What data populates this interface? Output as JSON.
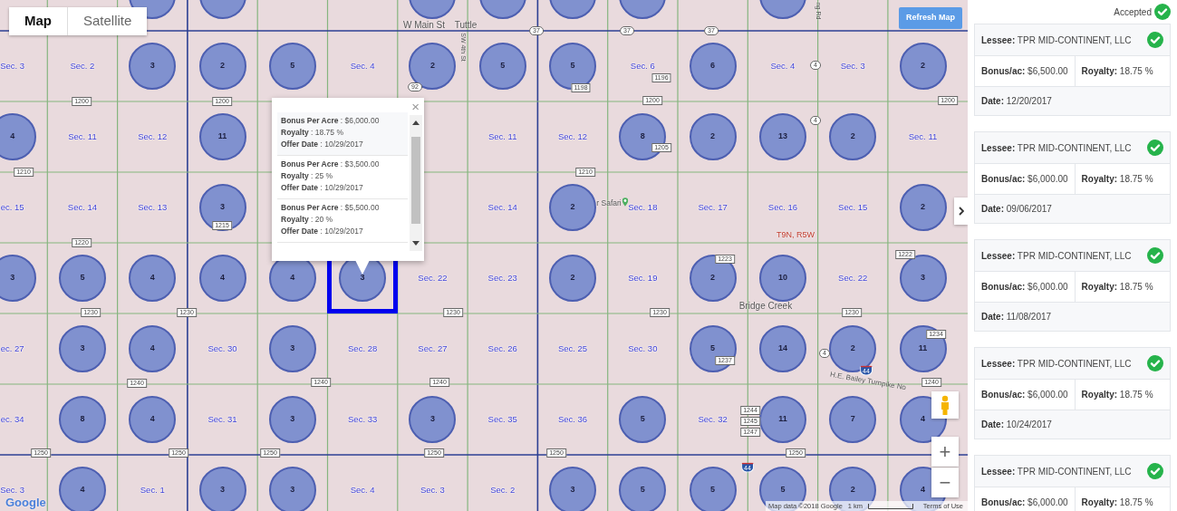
{
  "map_types": [
    {
      "label": "Map",
      "selected": true
    },
    {
      "label": "Satellite",
      "selected": false
    }
  ],
  "refresh_button": "Refresh Map",
  "map": {
    "rows": [
      [
        {
          "kind": "empty"
        },
        {
          "kind": "empty"
        },
        {
          "kind": "cut"
        },
        {
          "kind": "cut"
        },
        {
          "kind": "empty"
        },
        {
          "kind": "empty"
        },
        {
          "kind": "cut"
        },
        {
          "kind": "cut"
        },
        {
          "kind": "cut"
        },
        {
          "kind": "cut"
        },
        {
          "kind": "empty"
        },
        {
          "kind": "cut"
        },
        {
          "kind": "empty"
        },
        {
          "kind": "empty"
        }
      ],
      [
        {
          "kind": "section",
          "text": "Sec. 3"
        },
        {
          "kind": "section",
          "text": "Sec. 2"
        },
        {
          "kind": "cluster",
          "count": "3",
          "selected": false
        },
        {
          "kind": "cluster",
          "count": "2",
          "selected": false
        },
        {
          "kind": "cluster",
          "count": "5",
          "selected": false
        },
        {
          "kind": "section",
          "text": "Sec. 4"
        },
        {
          "kind": "cluster",
          "count": "2",
          "selected": false
        },
        {
          "kind": "cluster",
          "count": "5",
          "selected": false
        },
        {
          "kind": "cluster",
          "count": "5",
          "selected": false
        },
        {
          "kind": "section",
          "text": "Sec. 6"
        },
        {
          "kind": "cluster",
          "count": "6",
          "selected": false
        },
        {
          "kind": "section",
          "text": "Sec. 4"
        },
        {
          "kind": "section",
          "text": "Sec. 3"
        },
        {
          "kind": "cluster",
          "count": "2",
          "selected": false
        }
      ],
      [
        {
          "kind": "cluster",
          "count": "4",
          "selected": false
        },
        {
          "kind": "section",
          "text": "Sec. 11"
        },
        {
          "kind": "section",
          "text": "Sec. 12"
        },
        {
          "kind": "cluster",
          "count": "11",
          "selected": false
        },
        {
          "kind": "empty"
        },
        {
          "kind": "empty"
        },
        {
          "kind": "empty"
        },
        {
          "kind": "section",
          "text": "Sec. 11"
        },
        {
          "kind": "section",
          "text": "Sec. 12"
        },
        {
          "kind": "cluster",
          "count": "8",
          "selected": false
        },
        {
          "kind": "cluster",
          "count": "2",
          "selected": false
        },
        {
          "kind": "cluster",
          "count": "13",
          "selected": false
        },
        {
          "kind": "cluster",
          "count": "2",
          "selected": false
        },
        {
          "kind": "section",
          "text": "Sec. 11"
        }
      ],
      [
        {
          "kind": "section",
          "text": "ec. 15"
        },
        {
          "kind": "section",
          "text": "Sec. 14"
        },
        {
          "kind": "section",
          "text": "Sec. 13"
        },
        {
          "kind": "cluster",
          "count": "3",
          "selected": false
        },
        {
          "kind": "empty"
        },
        {
          "kind": "empty"
        },
        {
          "kind": "empty"
        },
        {
          "kind": "section",
          "text": "Sec. 14"
        },
        {
          "kind": "cluster",
          "count": "2",
          "selected": false
        },
        {
          "kind": "section",
          "text": "Sec. 18"
        },
        {
          "kind": "section",
          "text": "Sec. 17"
        },
        {
          "kind": "section",
          "text": "Sec. 16"
        },
        {
          "kind": "section",
          "text": "Sec. 15"
        },
        {
          "kind": "cluster",
          "count": "2",
          "selected": false
        }
      ],
      [
        {
          "kind": "cluster",
          "count": "3",
          "selected": false
        },
        {
          "kind": "cluster",
          "count": "5",
          "selected": false
        },
        {
          "kind": "cluster",
          "count": "4",
          "selected": false
        },
        {
          "kind": "cluster",
          "count": "4",
          "selected": false
        },
        {
          "kind": "cluster",
          "count": "4",
          "selected": false
        },
        {
          "kind": "cluster",
          "count": "3",
          "selected": true
        },
        {
          "kind": "section",
          "text": "Sec. 22"
        },
        {
          "kind": "section",
          "text": "Sec. 23"
        },
        {
          "kind": "cluster",
          "count": "2",
          "selected": false
        },
        {
          "kind": "section",
          "text": "Sec. 19"
        },
        {
          "kind": "cluster",
          "count": "2",
          "selected": false
        },
        {
          "kind": "cluster",
          "count": "10",
          "selected": false
        },
        {
          "kind": "section",
          "text": "Sec. 22"
        },
        {
          "kind": "cluster",
          "count": "3",
          "selected": false
        }
      ],
      [
        {
          "kind": "section",
          "text": "ec. 27"
        },
        {
          "kind": "cluster",
          "count": "3",
          "selected": false
        },
        {
          "kind": "cluster",
          "count": "4",
          "selected": false
        },
        {
          "kind": "section",
          "text": "Sec. 30"
        },
        {
          "kind": "cluster",
          "count": "3",
          "selected": false
        },
        {
          "kind": "section",
          "text": "Sec. 28"
        },
        {
          "kind": "section",
          "text": "Sec. 27"
        },
        {
          "kind": "section",
          "text": "Sec. 26"
        },
        {
          "kind": "section",
          "text": "Sec. 25"
        },
        {
          "kind": "section",
          "text": "Sec. 30"
        },
        {
          "kind": "cluster",
          "count": "5",
          "selected": false
        },
        {
          "kind": "cluster",
          "count": "14",
          "selected": false
        },
        {
          "kind": "cluster",
          "count": "2",
          "selected": false
        },
        {
          "kind": "cluster",
          "count": "11",
          "selected": false
        }
      ],
      [
        {
          "kind": "section",
          "text": "ec. 34"
        },
        {
          "kind": "cluster",
          "count": "8",
          "selected": false
        },
        {
          "kind": "cluster",
          "count": "4",
          "selected": false
        },
        {
          "kind": "section",
          "text": "Sec. 31"
        },
        {
          "kind": "cluster",
          "count": "3",
          "selected": false
        },
        {
          "kind": "section",
          "text": "Sec. 33"
        },
        {
          "kind": "cluster",
          "count": "3",
          "selected": false
        },
        {
          "kind": "section",
          "text": "Sec. 35"
        },
        {
          "kind": "section",
          "text": "Sec. 36"
        },
        {
          "kind": "cluster",
          "count": "5",
          "selected": false
        },
        {
          "kind": "section",
          "text": "Sec. 32"
        },
        {
          "kind": "cluster",
          "count": "11",
          "selected": false
        },
        {
          "kind": "cluster",
          "count": "7",
          "selected": false
        },
        {
          "kind": "cluster",
          "count": "4",
          "selected": false
        }
      ],
      [
        {
          "kind": "section",
          "text": "Sec. 3"
        },
        {
          "kind": "cluster",
          "count": "4",
          "selected": false
        },
        {
          "kind": "section",
          "text": "Sec. 1"
        },
        {
          "kind": "cluster",
          "count": "3",
          "selected": false
        },
        {
          "kind": "cluster",
          "count": "3",
          "selected": false
        },
        {
          "kind": "section",
          "text": "Sec. 4"
        },
        {
          "kind": "section",
          "text": "Sec. 3"
        },
        {
          "kind": "section",
          "text": "Sec. 2"
        },
        {
          "kind": "cluster",
          "count": "3",
          "selected": false
        },
        {
          "kind": "cluster",
          "count": "5",
          "selected": false
        },
        {
          "kind": "cluster",
          "count": "5",
          "selected": false
        },
        {
          "kind": "cluster",
          "count": "5",
          "selected": false
        },
        {
          "kind": "cluster",
          "count": "2",
          "selected": false
        },
        {
          "kind": "cluster",
          "count": "4",
          "selected": false
        }
      ]
    ],
    "places": [
      {
        "kind": "street",
        "text": "W Main St"
      },
      {
        "kind": "town",
        "text": "Tuttle"
      },
      {
        "kind": "street-vertical",
        "text": "SW 4th St"
      },
      {
        "kind": "street-vertical",
        "text": "ng Rd"
      },
      {
        "kind": "poi",
        "text": "r Safari"
      },
      {
        "kind": "township",
        "text": "T9N, R5W"
      },
      {
        "kind": "town",
        "text": "Bridge Creek"
      },
      {
        "kind": "highway",
        "text": "H.E. Bailey Turnpike No"
      }
    ],
    "roads": [
      {
        "kind": "county",
        "text": "1200"
      },
      {
        "kind": "county",
        "text": "1200"
      },
      {
        "kind": "county",
        "text": "1200"
      },
      {
        "kind": "county",
        "text": "1200"
      },
      {
        "kind": "county",
        "text": "1210"
      },
      {
        "kind": "county",
        "text": "1210"
      },
      {
        "kind": "county",
        "text": "1215"
      },
      {
        "kind": "county",
        "text": "1220"
      },
      {
        "kind": "county",
        "text": "1196"
      },
      {
        "kind": "county",
        "text": "1198"
      },
      {
        "kind": "county",
        "text": "1205"
      },
      {
        "kind": "state",
        "text": "92"
      },
      {
        "kind": "state",
        "text": "37"
      },
      {
        "kind": "state",
        "text": "37"
      },
      {
        "kind": "state",
        "text": "37"
      },
      {
        "kind": "state",
        "text": "4"
      },
      {
        "kind": "state",
        "text": "4"
      },
      {
        "kind": "county",
        "text": "1223"
      },
      {
        "kind": "county",
        "text": "1222"
      },
      {
        "kind": "county",
        "text": "1230"
      },
      {
        "kind": "county",
        "text": "1230"
      },
      {
        "kind": "county",
        "text": "1230"
      },
      {
        "kind": "county",
        "text": "1230"
      },
      {
        "kind": "county",
        "text": "1230"
      },
      {
        "kind": "county",
        "text": "1234"
      },
      {
        "kind": "county",
        "text": "1237"
      },
      {
        "kind": "state",
        "text": "4"
      },
      {
        "kind": "interstate",
        "text": "44"
      },
      {
        "kind": "county",
        "text": "1240"
      },
      {
        "kind": "county",
        "text": "1240"
      },
      {
        "kind": "county",
        "text": "1240"
      },
      {
        "kind": "county",
        "text": "1240"
      },
      {
        "kind": "county",
        "text": "1244"
      },
      {
        "kind": "county",
        "text": "1245"
      },
      {
        "kind": "county",
        "text": "1247"
      },
      {
        "kind": "county",
        "text": "1250"
      },
      {
        "kind": "county",
        "text": "1250"
      },
      {
        "kind": "county",
        "text": "1250"
      },
      {
        "kind": "county",
        "text": "1250"
      },
      {
        "kind": "county",
        "text": "1250"
      },
      {
        "kind": "county",
        "text": "1250"
      },
      {
        "kind": "interstate",
        "text": "44"
      }
    ]
  },
  "popup": {
    "close": "×",
    "offers": [
      {
        "bonus": "**Bonus Per Acre** : $6,000.00",
        "royalty": "**Royalty** : 18.75 %",
        "offer_date": "**Offer Date** : 10/29/2017"
      },
      {
        "bonus": "**Bonus Per Acre** : $3,500.00",
        "royalty": "**Royalty** : 25 %",
        "offer_date": "**Offer Date** : 10/29/2017"
      },
      {
        "bonus": "**Bonus Per Acre** : $5,500.00",
        "royalty": "**Royalty** : 20 %",
        "offer_date": "**Offer Date** : 10/29/2017"
      }
    ]
  },
  "zoom": {
    "in": "+",
    "out": "−"
  },
  "attribution": {
    "logo": "Google",
    "data": "Map data ©2018 Google",
    "scale": "1 km",
    "terms": "Terms of Use"
  },
  "sidebar": {
    "heading": "Accepted",
    "cards": [
      {
        "lessee": "**Lessee:** TPR MID-CONTINENT, LLC",
        "accepted": true,
        "bonus": "**Bonus/ac:** $6,500.00",
        "royalty": "**Royalty:** 18.75 %",
        "date": "**Date:** 12/20/2017"
      },
      {
        "lessee": "**Lessee:** TPR MID-CONTINENT, LLC",
        "accepted": true,
        "bonus": "**Bonus/ac:** $6,000.00",
        "royalty": "**Royalty:** 18.75 %",
        "date": "**Date:** 09/06/2017"
      },
      {
        "lessee": "**Lessee:** TPR MID-CONTINENT, LLC",
        "accepted": true,
        "bonus": "**Bonus/ac:** $6,000.00",
        "royalty": "**Royalty:** 18.75 %",
        "date": "**Date:** 11/08/2017"
      },
      {
        "lessee": "**Lessee:** TPR MID-CONTINENT, LLC",
        "accepted": true,
        "bonus": "**Bonus/ac:** $6,000.00",
        "royalty": "**Royalty:** 18.75 %",
        "date": "**Date:** 10/24/2017"
      },
      {
        "lessee": "**Lessee:** TPR MID-CONTINENT, LLC",
        "accepted": true,
        "bonus": "**Bonus/ac:** $6,000.00",
        "royalty": "**Royalty:** 18.75 %"
      }
    ]
  }
}
